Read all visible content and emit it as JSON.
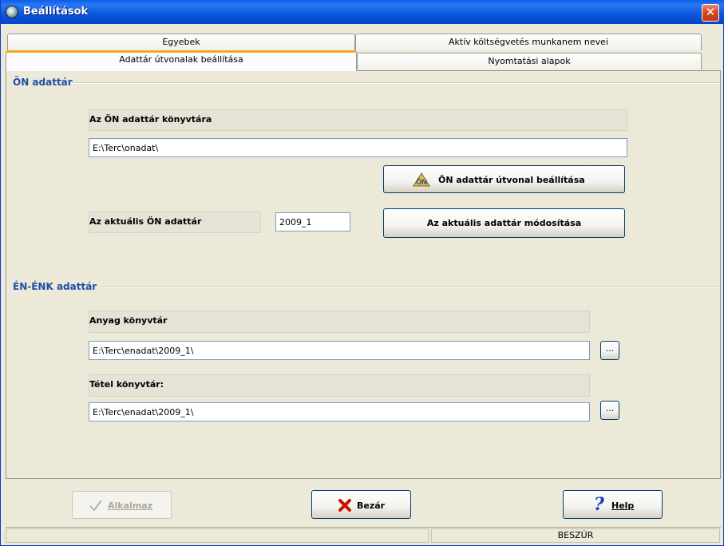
{
  "window": {
    "title": "Beállítások",
    "close_label": "✕"
  },
  "tabs": {
    "row1": [
      "Egyebek",
      "Aktív költségvetés munkanem nevei"
    ],
    "row2": [
      "Adattár útvonalak beállítása",
      "Nyomtatási alapok"
    ]
  },
  "on_group": {
    "title": "ÖN adattár",
    "dir_label": "Az ÖN adattár könyvtára",
    "dir_value": "E:\\Terc\\onadat\\",
    "set_path_button": "ÖN adattár útvonal beállítása",
    "current_label": "Az aktuális ÖN adattár",
    "current_value": "2009_1",
    "modify_button": "Az aktuális adattár módosítása"
  },
  "enenk_group": {
    "title": "ÉN-ÉNK adattár",
    "material_label": "Anyag könyvtár",
    "material_value": "E:\\Terc\\enadat\\2009_1\\",
    "item_label": "Tétel könyvtár:",
    "item_value": "E:\\Terc\\enadat\\2009_1\\",
    "browse_label": "..."
  },
  "footer": {
    "apply_label": "Alkalmaz",
    "close_label": "Bezár",
    "help_label": "Help"
  },
  "statusbar": {
    "mode": "BESZÚR"
  },
  "icons": {
    "apply": "checkmark-icon",
    "close": "red-x-icon",
    "help": "question-mark-icon"
  },
  "colors": {
    "titlebar": "#0a5de8",
    "group_title": "#1f4fa8",
    "active_tab_accent": "#f5a61c",
    "close_x": "#cc1100",
    "help_q": "#1c3fb8"
  }
}
